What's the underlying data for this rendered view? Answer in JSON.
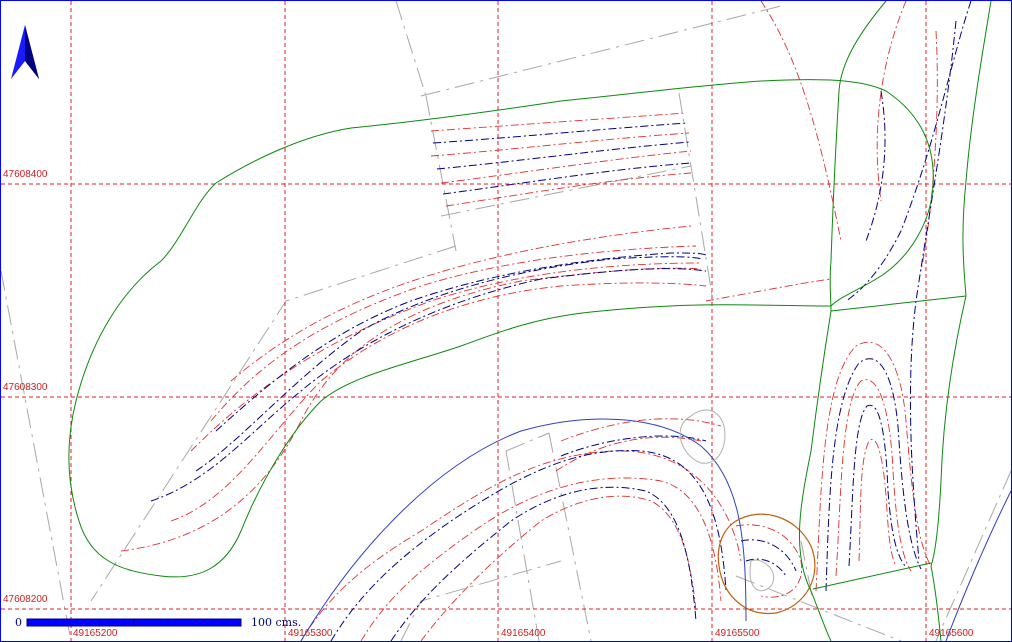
{
  "map": {
    "grid": {
      "x_labels": [
        "49165200",
        "49165300",
        "49165400",
        "49165500",
        "49165600"
      ],
      "y_labels": [
        "47608400",
        "47608300",
        "47608200"
      ]
    },
    "scale_bar": {
      "start_label": "0",
      "end_label": "100 cms."
    },
    "north_arrow_icon": "north-arrow-icon",
    "colors": {
      "grid": "#e02020",
      "contour_red": "#e03030",
      "contour_blue": "#000080",
      "parcel_green": "#0a8a0a",
      "road_gray": "#a8a8a8",
      "stream_blue": "#3040c0",
      "pond_orange": "#c06010",
      "frame_blue": "#0000ff"
    }
  }
}
